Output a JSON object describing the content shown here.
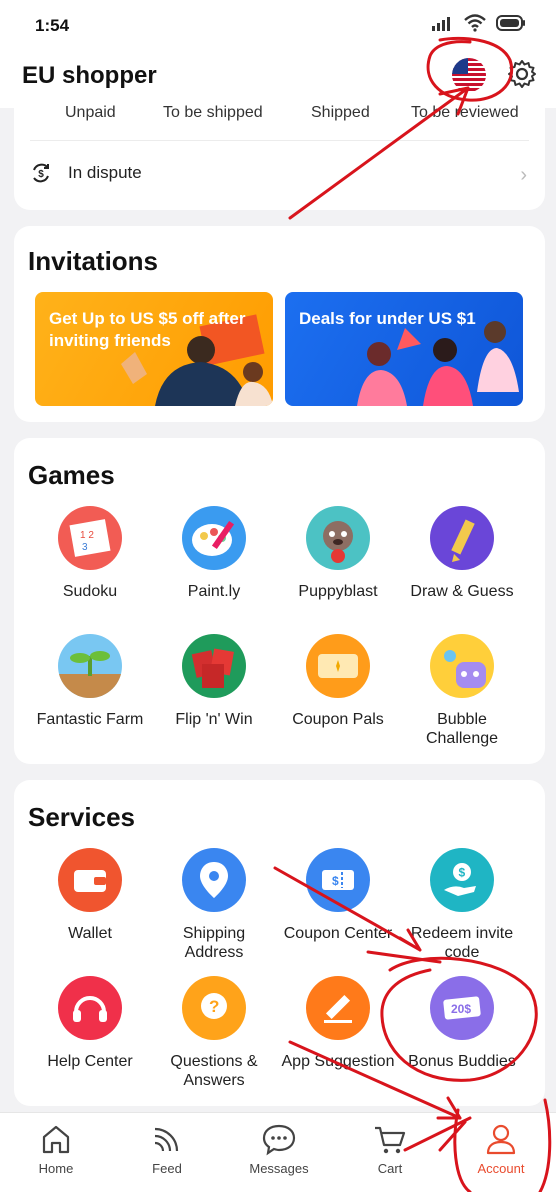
{
  "status_bar": {
    "time": "1:54"
  },
  "header": {
    "title": "EU shopper"
  },
  "orders": {
    "tabs": [
      "Unpaid",
      "To be shipped",
      "Shipped",
      "To be reviewed"
    ],
    "dispute_label": "In dispute"
  },
  "invitations": {
    "title": "Invitations",
    "banners": [
      {
        "text": "Get Up to US $5 off after inviting friends"
      },
      {
        "text": "Deals for under US $1"
      }
    ]
  },
  "games": {
    "title": "Games",
    "items": [
      {
        "label": "Sudoku"
      },
      {
        "label": "Paint.ly"
      },
      {
        "label": "Puppyblast"
      },
      {
        "label": "Draw & Guess"
      },
      {
        "label": "Fantastic Farm"
      },
      {
        "label": "Flip 'n' Win"
      },
      {
        "label": "Coupon Pals"
      },
      {
        "label": "Bubble Challenge"
      }
    ]
  },
  "services": {
    "title": "Services",
    "items": [
      {
        "label": "Wallet"
      },
      {
        "label": "Shipping Address"
      },
      {
        "label": "Coupon Center"
      },
      {
        "label": "Redeem invite code"
      },
      {
        "label": "Help Center"
      },
      {
        "label": "Questions & Answers"
      },
      {
        "label": "App Suggestion"
      },
      {
        "label": "Bonus Buddies"
      }
    ]
  },
  "tabbar": {
    "items": [
      {
        "label": "Home"
      },
      {
        "label": "Feed"
      },
      {
        "label": "Messages"
      },
      {
        "label": "Cart"
      },
      {
        "label": "Account"
      }
    ]
  },
  "colors": {
    "accent": "#e94b2e",
    "annotation": "#d8141c"
  }
}
